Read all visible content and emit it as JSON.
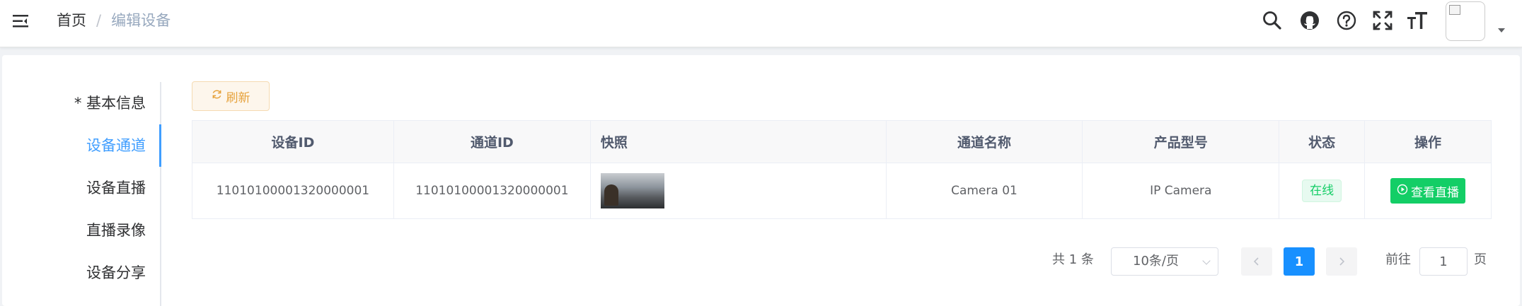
{
  "breadcrumb": {
    "home": "首页",
    "separator": "/",
    "current": "编辑设备"
  },
  "header_icons": [
    "hamburger-icon",
    "search-icon",
    "github-icon",
    "question-icon",
    "fullscreen-icon",
    "font-size-icon"
  ],
  "tabs": [
    {
      "label": "* 基本信息",
      "active": false
    },
    {
      "label": "设备通道",
      "active": true
    },
    {
      "label": "设备直播",
      "active": false
    },
    {
      "label": "直播录像",
      "active": false
    },
    {
      "label": "设备分享",
      "active": false
    }
  ],
  "refresh_button": {
    "label": "刷新",
    "icon": "refresh-icon"
  },
  "table": {
    "headers": [
      "设备ID",
      "通道ID",
      "快照",
      "通道名称",
      "产品型号",
      "状态",
      "操作"
    ],
    "rows": [
      {
        "device_id": "11010100001320000001",
        "channel_id": "11010100001320000001",
        "channel_name": "Camera 01",
        "product_model": "IP Camera",
        "status": "在线",
        "action": "查看直播"
      }
    ]
  },
  "pagination": {
    "total_text": "共 1 条",
    "page_size": "10条/页",
    "current_page": "1",
    "goto_label": "前往",
    "goto_value": "1",
    "page_suffix": "页"
  },
  "colors": {
    "primary": "#409eff",
    "success": "#13ce66",
    "warning": "#e6a23c",
    "pager_active": "#1890ff"
  }
}
